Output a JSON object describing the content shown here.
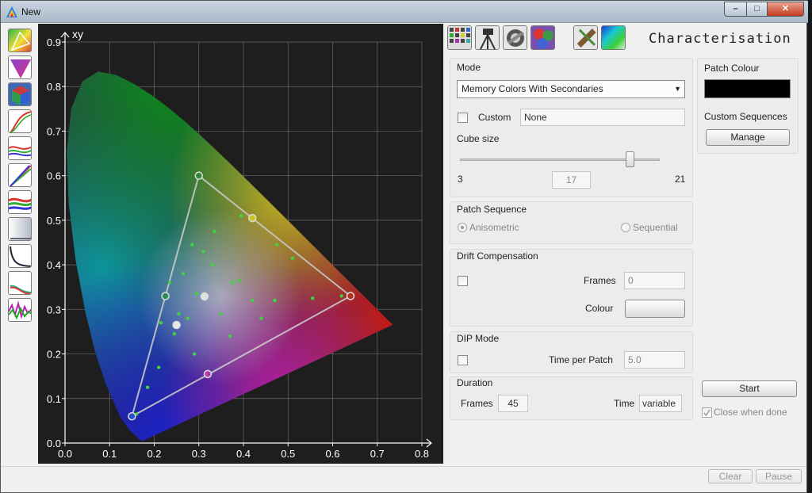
{
  "window": {
    "title": "New",
    "min_glyph": "–",
    "max_glyph": "□",
    "close_glyph": "✕"
  },
  "left_toolbar": {
    "icons": [
      "chromaticity-tool-icon",
      "gamut-tool-icon",
      "cube-tool-icon",
      "curve-tool-icon",
      "rgb-balance-icon",
      "gamma-curve-icon",
      "luminance-rgb-icon",
      "grey-ramp-icon",
      "grey-curve-icon",
      "shadow-curve-icon",
      "noise-curve-icon"
    ]
  },
  "top_toolbar": {
    "icons": [
      "calibration-grid-icon",
      "tripod-icon",
      "connector-icon",
      "color-swatch-icon",
      "ruler-tool-icon",
      "spectrum-tool-icon"
    ]
  },
  "page_title": "Characterisation",
  "plot": {
    "axis_label": "xy",
    "x_ticks": [
      "0.0",
      "0.1",
      "0.2",
      "0.3",
      "0.4",
      "0.5",
      "0.6",
      "0.7",
      "0.8"
    ],
    "y_ticks": [
      "0.0",
      "0.1",
      "0.2",
      "0.3",
      "0.4",
      "0.5",
      "0.6",
      "0.7",
      "0.8",
      "0.9"
    ]
  },
  "chart_data": {
    "type": "scatter",
    "title": "",
    "xlabel": "",
    "ylabel": "xy",
    "xlim": [
      0.0,
      0.8
    ],
    "ylim": [
      0.0,
      0.9
    ],
    "grid": true,
    "gamut_triangle": {
      "red": [
        0.64,
        0.33
      ],
      "green": [
        0.3,
        0.6
      ],
      "blue": [
        0.15,
        0.06
      ]
    },
    "gamut_markers": [
      {
        "x": 0.64,
        "y": 0.33,
        "color": "#b33020"
      },
      {
        "x": 0.3,
        "y": 0.6,
        "color": "#2e8b2e"
      },
      {
        "x": 0.15,
        "y": 0.06,
        "color": "#2a4bd0"
      },
      {
        "x": 0.225,
        "y": 0.33,
        "color": "#2e8b57"
      },
      {
        "x": 0.42,
        "y": 0.505,
        "color": "#c8c820"
      },
      {
        "x": 0.32,
        "y": 0.155,
        "color": "#b040b0"
      },
      {
        "x": 0.3127,
        "y": 0.329,
        "color": "#e0e0e0"
      },
      {
        "x": 0.25,
        "y": 0.265,
        "color": "#e8e8e8"
      }
    ],
    "patches": {
      "x": [
        0.16,
        0.185,
        0.21,
        0.215,
        0.235,
        0.245,
        0.255,
        0.265,
        0.275,
        0.285,
        0.29,
        0.295,
        0.31,
        0.33,
        0.335,
        0.35,
        0.37,
        0.375,
        0.39,
        0.395,
        0.42,
        0.44,
        0.47,
        0.475,
        0.51,
        0.555,
        0.62
      ],
      "y": [
        0.065,
        0.125,
        0.17,
        0.27,
        0.36,
        0.245,
        0.29,
        0.38,
        0.28,
        0.445,
        0.2,
        0.335,
        0.43,
        0.4,
        0.475,
        0.29,
        0.24,
        0.36,
        0.365,
        0.51,
        0.32,
        0.28,
        0.32,
        0.445,
        0.415,
        0.325,
        0.33
      ]
    }
  },
  "mode": {
    "label": "Mode",
    "selected": "Memory Colors With Secondaries",
    "custom_label": "Custom",
    "custom_value": "None",
    "cube_size_label": "Cube size",
    "cube_min": "3",
    "cube_max": "21",
    "cube_value": "17"
  },
  "patch_colour": {
    "label": "Patch Colour",
    "swatch": "#000000"
  },
  "custom_sequences": {
    "label": "Custom Sequences",
    "manage_label": "Manage"
  },
  "patch_sequence": {
    "label": "Patch Sequence",
    "option_1": "Anisometric",
    "option_2": "Sequential"
  },
  "drift": {
    "label": "Drift Compensation",
    "frames_label": "Frames",
    "frames_value": "0",
    "colour_label": "Colour"
  },
  "dip": {
    "label": "DIP Mode",
    "time_label": "Time per Patch",
    "time_value": "5.0"
  },
  "duration": {
    "label": "Duration",
    "frames_label": "Frames",
    "frames_value": "45",
    "time_label": "Time",
    "time_value": "variable"
  },
  "actions": {
    "start_label": "Start",
    "close_when_done": "Close when done",
    "clear_label": "Clear",
    "pause_label": "Pause"
  }
}
